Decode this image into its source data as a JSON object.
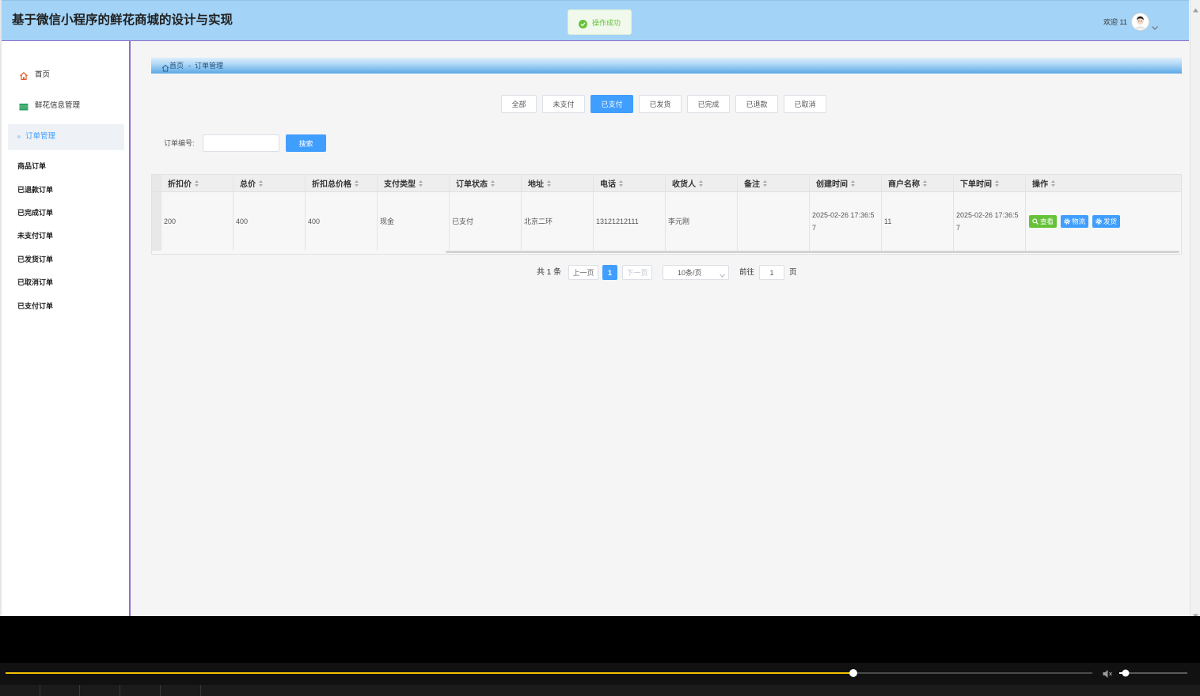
{
  "theme": {
    "accent": "#409eff",
    "success": "#67c23a",
    "header_bg": "#a3d3f6",
    "sidebar_border": "#8a70c8",
    "progress": "#f2c200"
  },
  "header": {
    "title": "基于微信小程序的鲜花商城的设计与实现",
    "welcome": "欢迎 11",
    "avatar_icon": "avatar-icon",
    "menu_icon": "chevron-down-icon"
  },
  "toast": {
    "message": "操作成功",
    "icon": "check-circle-icon"
  },
  "sidebar": {
    "menu": [
      {
        "label": "首页",
        "icon": "home-icon",
        "active": false
      },
      {
        "label": "鲜花信息管理",
        "icon": "flower-info-icon",
        "active": false
      },
      {
        "label": "订单管理",
        "icon": "dot-icon",
        "active": true
      }
    ],
    "submenu": [
      {
        "label": "商品订单"
      },
      {
        "label": "已退款订单"
      },
      {
        "label": "已完成订单"
      },
      {
        "label": "未支付订单"
      },
      {
        "label": "已发货订单"
      },
      {
        "label": "已取消订单"
      },
      {
        "label": "已支付订单"
      }
    ]
  },
  "breadcrumb": {
    "icon": "home-icon",
    "home": "首页",
    "separator": "-",
    "current": "订单管理"
  },
  "status_tabs": {
    "active": 2,
    "items": [
      "全部",
      "未支付",
      "已支付",
      "已发货",
      "已完成",
      "已退款",
      "已取消"
    ]
  },
  "search": {
    "label": "订单编号:",
    "value": "",
    "button_label": "搜索"
  },
  "table": {
    "columns": [
      "折扣价",
      "总价",
      "折扣总价格",
      "支付类型",
      "订单状态",
      "地址",
      "电话",
      "收货人",
      "备注",
      "创建时间",
      "商户名称",
      "下单时间",
      "操作"
    ],
    "rows": [
      {
        "discount_price": "200",
        "total_price": "400",
        "discount_total": "400",
        "pay_type": "现金",
        "status": "已支付",
        "address": "北京二环",
        "phone": "13121212111",
        "receiver": "李元刚",
        "note": "",
        "created_at": "2025-02-26 17:36:57",
        "merchant": "11",
        "ordered_at": "2025-02-26 17:36:57"
      }
    ],
    "actions": [
      {
        "label": "查看",
        "icon": "search-icon",
        "color": "#67c23a"
      },
      {
        "label": "物流",
        "icon": "gear-icon",
        "color": "#409eff"
      },
      {
        "label": "发货",
        "icon": "gear-icon",
        "color": "#409eff"
      }
    ]
  },
  "pagination": {
    "total": "共 1 条",
    "prev": "上一页",
    "current": "1",
    "next": "下一页",
    "page_size": "10条/页",
    "goto": "前往",
    "goto_value": "1",
    "unit": "页"
  },
  "player": {
    "progress": 0.78,
    "volume": 0.09,
    "volume_icon": "volume-icon"
  }
}
